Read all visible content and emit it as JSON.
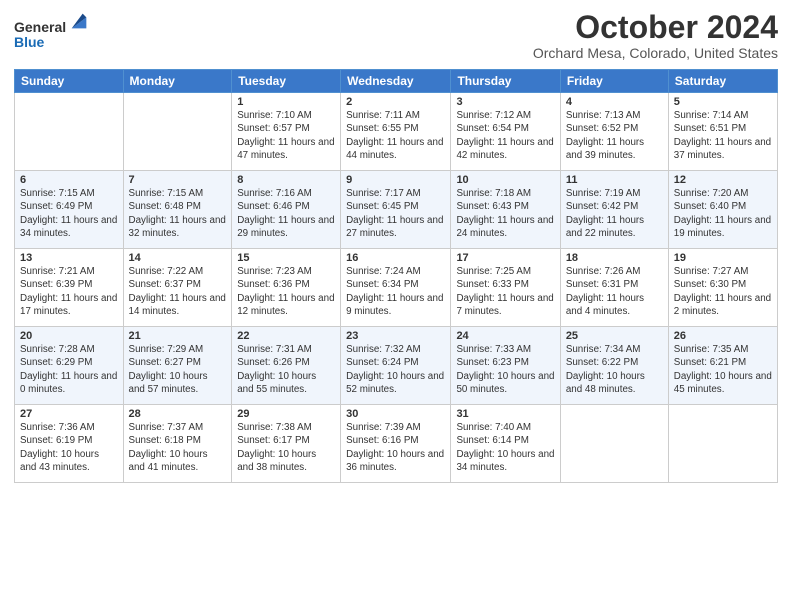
{
  "header": {
    "logo_line1": "General",
    "logo_line2": "Blue",
    "month_title": "October 2024",
    "location": "Orchard Mesa, Colorado, United States"
  },
  "days_of_week": [
    "Sunday",
    "Monday",
    "Tuesday",
    "Wednesday",
    "Thursday",
    "Friday",
    "Saturday"
  ],
  "weeks": [
    [
      {
        "day": "",
        "info": ""
      },
      {
        "day": "",
        "info": ""
      },
      {
        "day": "1",
        "info": "Sunrise: 7:10 AM\nSunset: 6:57 PM\nDaylight: 11 hours and 47 minutes."
      },
      {
        "day": "2",
        "info": "Sunrise: 7:11 AM\nSunset: 6:55 PM\nDaylight: 11 hours and 44 minutes."
      },
      {
        "day": "3",
        "info": "Sunrise: 7:12 AM\nSunset: 6:54 PM\nDaylight: 11 hours and 42 minutes."
      },
      {
        "day": "4",
        "info": "Sunrise: 7:13 AM\nSunset: 6:52 PM\nDaylight: 11 hours and 39 minutes."
      },
      {
        "day": "5",
        "info": "Sunrise: 7:14 AM\nSunset: 6:51 PM\nDaylight: 11 hours and 37 minutes."
      }
    ],
    [
      {
        "day": "6",
        "info": "Sunrise: 7:15 AM\nSunset: 6:49 PM\nDaylight: 11 hours and 34 minutes."
      },
      {
        "day": "7",
        "info": "Sunrise: 7:15 AM\nSunset: 6:48 PM\nDaylight: 11 hours and 32 minutes."
      },
      {
        "day": "8",
        "info": "Sunrise: 7:16 AM\nSunset: 6:46 PM\nDaylight: 11 hours and 29 minutes."
      },
      {
        "day": "9",
        "info": "Sunrise: 7:17 AM\nSunset: 6:45 PM\nDaylight: 11 hours and 27 minutes."
      },
      {
        "day": "10",
        "info": "Sunrise: 7:18 AM\nSunset: 6:43 PM\nDaylight: 11 hours and 24 minutes."
      },
      {
        "day": "11",
        "info": "Sunrise: 7:19 AM\nSunset: 6:42 PM\nDaylight: 11 hours and 22 minutes."
      },
      {
        "day": "12",
        "info": "Sunrise: 7:20 AM\nSunset: 6:40 PM\nDaylight: 11 hours and 19 minutes."
      }
    ],
    [
      {
        "day": "13",
        "info": "Sunrise: 7:21 AM\nSunset: 6:39 PM\nDaylight: 11 hours and 17 minutes."
      },
      {
        "day": "14",
        "info": "Sunrise: 7:22 AM\nSunset: 6:37 PM\nDaylight: 11 hours and 14 minutes."
      },
      {
        "day": "15",
        "info": "Sunrise: 7:23 AM\nSunset: 6:36 PM\nDaylight: 11 hours and 12 minutes."
      },
      {
        "day": "16",
        "info": "Sunrise: 7:24 AM\nSunset: 6:34 PM\nDaylight: 11 hours and 9 minutes."
      },
      {
        "day": "17",
        "info": "Sunrise: 7:25 AM\nSunset: 6:33 PM\nDaylight: 11 hours and 7 minutes."
      },
      {
        "day": "18",
        "info": "Sunrise: 7:26 AM\nSunset: 6:31 PM\nDaylight: 11 hours and 4 minutes."
      },
      {
        "day": "19",
        "info": "Sunrise: 7:27 AM\nSunset: 6:30 PM\nDaylight: 11 hours and 2 minutes."
      }
    ],
    [
      {
        "day": "20",
        "info": "Sunrise: 7:28 AM\nSunset: 6:29 PM\nDaylight: 11 hours and 0 minutes."
      },
      {
        "day": "21",
        "info": "Sunrise: 7:29 AM\nSunset: 6:27 PM\nDaylight: 10 hours and 57 minutes."
      },
      {
        "day": "22",
        "info": "Sunrise: 7:31 AM\nSunset: 6:26 PM\nDaylight: 10 hours and 55 minutes."
      },
      {
        "day": "23",
        "info": "Sunrise: 7:32 AM\nSunset: 6:24 PM\nDaylight: 10 hours and 52 minutes."
      },
      {
        "day": "24",
        "info": "Sunrise: 7:33 AM\nSunset: 6:23 PM\nDaylight: 10 hours and 50 minutes."
      },
      {
        "day": "25",
        "info": "Sunrise: 7:34 AM\nSunset: 6:22 PM\nDaylight: 10 hours and 48 minutes."
      },
      {
        "day": "26",
        "info": "Sunrise: 7:35 AM\nSunset: 6:21 PM\nDaylight: 10 hours and 45 minutes."
      }
    ],
    [
      {
        "day": "27",
        "info": "Sunrise: 7:36 AM\nSunset: 6:19 PM\nDaylight: 10 hours and 43 minutes."
      },
      {
        "day": "28",
        "info": "Sunrise: 7:37 AM\nSunset: 6:18 PM\nDaylight: 10 hours and 41 minutes."
      },
      {
        "day": "29",
        "info": "Sunrise: 7:38 AM\nSunset: 6:17 PM\nDaylight: 10 hours and 38 minutes."
      },
      {
        "day": "30",
        "info": "Sunrise: 7:39 AM\nSunset: 6:16 PM\nDaylight: 10 hours and 36 minutes."
      },
      {
        "day": "31",
        "info": "Sunrise: 7:40 AM\nSunset: 6:14 PM\nDaylight: 10 hours and 34 minutes."
      },
      {
        "day": "",
        "info": ""
      },
      {
        "day": "",
        "info": ""
      }
    ]
  ]
}
